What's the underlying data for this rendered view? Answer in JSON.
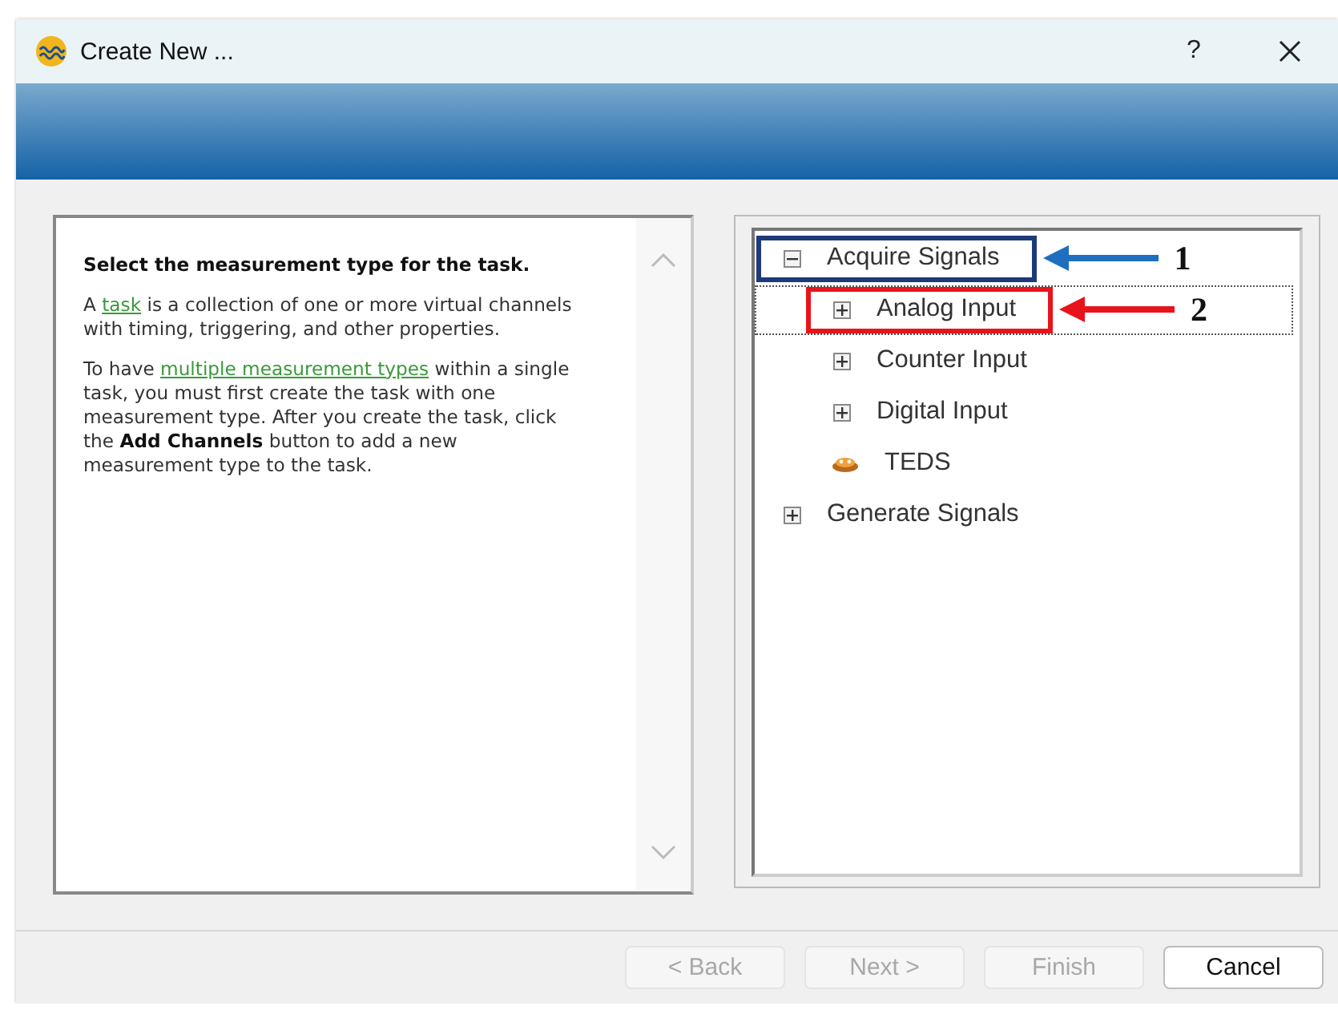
{
  "window": {
    "title": "Create New ...",
    "help": "?"
  },
  "help_text": {
    "heading": "Select the measurement type for the task.",
    "paragraphs": [
      [
        {
          "kind": "text",
          "text": "A "
        },
        {
          "kind": "link",
          "text": "task"
        },
        {
          "kind": "text",
          "text": " is a collection of one or more virtual channels with timing, triggering, and other properties."
        }
      ],
      [
        {
          "kind": "text",
          "text": "To have "
        },
        {
          "kind": "link",
          "text": "multiple measurement types"
        },
        {
          "kind": "text",
          "text": " within a single task, you must first create the task with one measurement type. After you create the task, click the "
        },
        {
          "kind": "bold",
          "text": "Add Channels"
        },
        {
          "kind": "text",
          "text": " button to add a new measurement type to the task."
        }
      ]
    ]
  },
  "tree": [
    {
      "label": "Acquire Signals",
      "kind": "folder",
      "expanded": true,
      "selected": false,
      "highlight": {
        "color": "#1f3a7a"
      },
      "callout": {
        "number": "1",
        "color": "#1f6fc0"
      },
      "children": [
        {
          "label": "Analog Input",
          "kind": "folder",
          "expanded": false,
          "selected": true,
          "highlight": {
            "color": "#e8141b"
          },
          "callout": {
            "number": "2",
            "color": "#e8141b"
          }
        },
        {
          "label": "Counter Input",
          "kind": "folder",
          "expanded": false,
          "selected": false
        },
        {
          "label": "Digital Input",
          "kind": "folder",
          "expanded": false,
          "selected": false
        },
        {
          "label": "TEDS",
          "kind": "teds",
          "selected": false
        }
      ]
    },
    {
      "label": "Generate Signals",
      "kind": "folder",
      "expanded": false,
      "selected": false
    }
  ],
  "buttons": [
    {
      "label": "< Back",
      "disabled": true
    },
    {
      "label": "Next >",
      "disabled": true
    },
    {
      "label": "Finish",
      "disabled": true
    },
    {
      "label": "Cancel",
      "disabled": false
    }
  ]
}
